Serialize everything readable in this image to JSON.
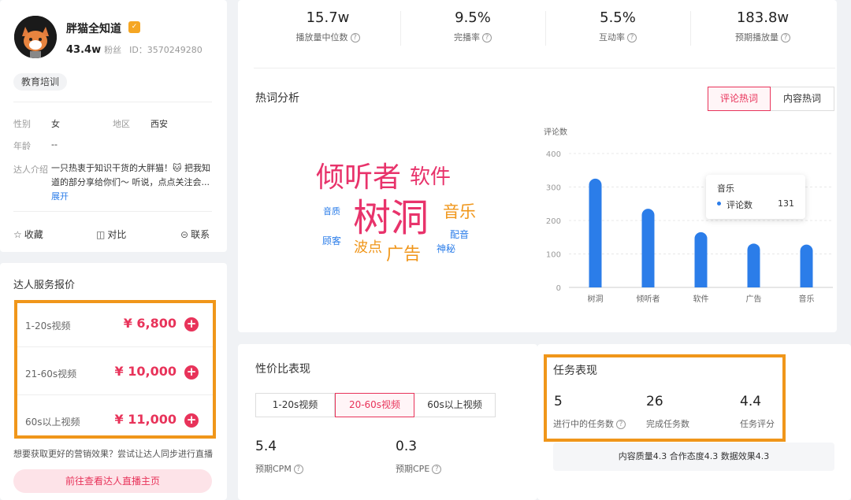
{
  "profile": {
    "name": "胖猫全知道",
    "followers": "43.4w",
    "followers_label": "粉丝",
    "id_text": "ID：3570249280",
    "tag": "教育培训",
    "gender_label": "性别",
    "gender": "女",
    "region_label": "地区",
    "region": "西安",
    "age_label": "年龄",
    "age": "--",
    "bio_label": "达人介绍",
    "bio": "一只热衷于知识干货的大胖猫！🐱 把我知道的部分享给你们～ 听说，点点关注会...",
    "expand": "展开",
    "actions": {
      "favorite": "收藏",
      "compare": "对比",
      "contact": "联系"
    }
  },
  "price": {
    "title": "达人服务报价",
    "rows": [
      {
        "label": "1-20s视频",
        "value": "¥ 6,800"
      },
      {
        "label": "21-60s视频",
        "value": "¥ 10,000"
      },
      {
        "label": "60s以上视频",
        "value": "¥ 11,000"
      }
    ],
    "hint": "想要获取更好的营销效果？尝试让达人同步进行直播",
    "live_button": "前往查看达人直播主页"
  },
  "stats": [
    {
      "value": "15.7w",
      "label": "播放量中位数"
    },
    {
      "value": "9.5%",
      "label": "完播率"
    },
    {
      "value": "5.5%",
      "label": "互动率"
    },
    {
      "value": "183.8w",
      "label": "预期播放量"
    }
  ],
  "hotwords": {
    "title": "热词分析",
    "tab_comment": "评论热词",
    "tab_content": "内容热词",
    "words": {
      "w1": "倾听者",
      "w2": "软件",
      "w3": "树洞",
      "w4": "音乐",
      "w5": "音质",
      "w6": "配音",
      "w7": "顾客",
      "w8": "波点",
      "w9": "广告",
      "w10": "神秘"
    },
    "colors": {
      "pink": "#e8336b",
      "orange": "#f0961a",
      "blue": "#2b7de9"
    }
  },
  "chart_data": {
    "type": "bar",
    "ylabel": "评论数",
    "categories": [
      "树洞",
      "倾听者",
      "软件",
      "广告",
      "音乐"
    ],
    "values": [
      325,
      235,
      165,
      131,
      128
    ],
    "ylim": [
      0,
      400
    ],
    "yticks": [
      "400",
      "300",
      "200",
      "100",
      "0"
    ],
    "grid": true,
    "color": "#2b7de9",
    "tooltip": {
      "category": "音乐",
      "series": "评论数",
      "value": "131"
    }
  },
  "value_perf": {
    "title": "性价比表现",
    "tabs": [
      "1-20s视频",
      "20-60s视频",
      "60s以上视频"
    ],
    "cpm_value": "5.4",
    "cpm_label": "预期CPM",
    "cpe_value": "0.3",
    "cpe_label": "预期CPE"
  },
  "task": {
    "title": "任务表现",
    "in_progress_value": "5",
    "in_progress_label": "进行中的任务数",
    "completed_value": "26",
    "completed_label": "完成任务数",
    "rating_value": "4.4",
    "rating_label": "任务评分",
    "summary": "内容质量4.3  合作态度4.3  数据效果4.3"
  }
}
